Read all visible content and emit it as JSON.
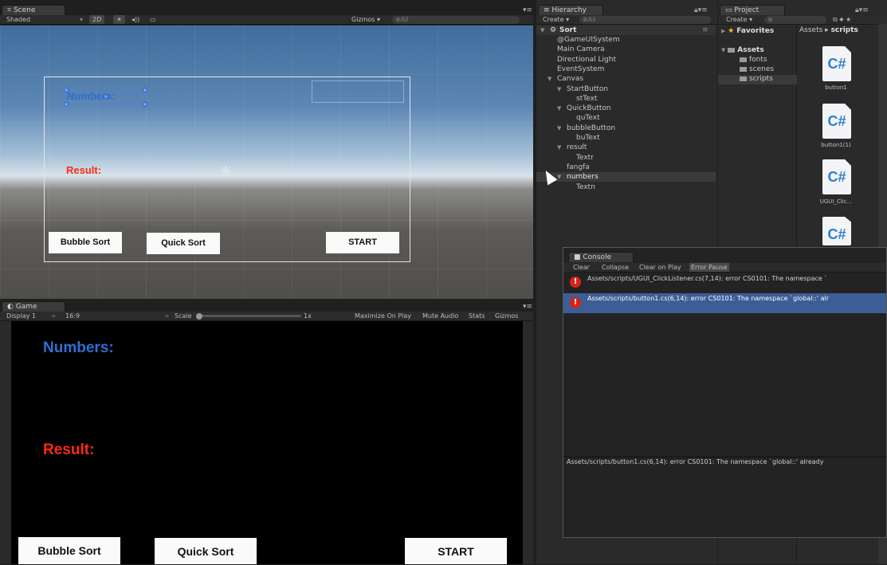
{
  "scene": {
    "tab": "Scene",
    "toolbar": {
      "shading": "Shaded",
      "mode2d": "2D",
      "light": "☀",
      "audio": "◂))",
      "fx": "▭",
      "gizmos": "Gizmos ▾",
      "search": "⊕All"
    },
    "canvas_labels": {
      "numbers": "Numbers:",
      "result": "Result:"
    },
    "buttons": {
      "bubble": "Bubble Sort",
      "quick": "Quick Sort",
      "start": "START"
    }
  },
  "game": {
    "tab": "Game",
    "toolbar": {
      "display": "Display 1",
      "aspect": "16:9",
      "scale_label": "Scale",
      "scale_value": "1x",
      "maximize": "Maximize On Play",
      "mute": "Mute Audio",
      "stats": "Stats",
      "gizmos": "Gizmos"
    },
    "labels": {
      "numbers": "Numbers:",
      "result": "Result:"
    },
    "buttons": {
      "bubble": "Bubble Sort",
      "quick": "Quick Sort",
      "start": "START"
    }
  },
  "hierarchy": {
    "tab": "Hierarchy",
    "create": "Create ▾",
    "search": "⊕All",
    "scene_name": "Sort",
    "items": [
      {
        "label": "@GameUISystem",
        "indent": 0,
        "arrow": false
      },
      {
        "label": "Main Camera",
        "indent": 0,
        "arrow": false
      },
      {
        "label": "Directional Light",
        "indent": 0,
        "arrow": false
      },
      {
        "label": "EventSystem",
        "indent": 0,
        "arrow": false
      },
      {
        "label": "Canvas",
        "indent": 0,
        "arrow": true
      },
      {
        "label": "StartButton",
        "indent": 1,
        "arrow": true
      },
      {
        "label": "stText",
        "indent": 2,
        "arrow": false
      },
      {
        "label": "QuickButton",
        "indent": 1,
        "arrow": true
      },
      {
        "label": "quText",
        "indent": 2,
        "arrow": false
      },
      {
        "label": "bubbleButton",
        "indent": 1,
        "arrow": true
      },
      {
        "label": "buText",
        "indent": 2,
        "arrow": false
      },
      {
        "label": "result",
        "indent": 1,
        "arrow": true
      },
      {
        "label": "Textr",
        "indent": 2,
        "arrow": false
      },
      {
        "label": "fangfa",
        "indent": 1,
        "arrow": false
      },
      {
        "label": "numbers",
        "indent": 1,
        "arrow": true,
        "selected": true
      },
      {
        "label": "Textn",
        "indent": 2,
        "arrow": false
      }
    ]
  },
  "project": {
    "tab": "Project",
    "create": "Create ▾",
    "favorites": "Favorites",
    "assets": "Assets",
    "folders": [
      "fonts",
      "scenes",
      "scripts"
    ],
    "breadcrumb": {
      "root": "Assets",
      "sep": "▸",
      "current": "scripts"
    },
    "files": [
      "button1",
      "button1(1)",
      "UGUI_Clic..."
    ],
    "cs_glyph": "C#"
  },
  "console": {
    "tab": "Console",
    "buttons": [
      "Clear",
      "Collapse",
      "Clear on Play",
      "Error Pause"
    ],
    "errors": [
      "Assets/scripts/UGUI_ClickListener.cs(7,14): error CS0101: The namespace `",
      "Assets/scripts/button1.cs(6,14): error CS0101: The namespace `global::' alr"
    ],
    "detail": "Assets/scripts/button1.cs(6,14): error CS0101: The namespace `global::' already"
  },
  "colors": {
    "numbers_blue": "#2f6fd0",
    "result_red": "#ff2a14",
    "selection": "#3c5e96",
    "error_red": "#d4231a"
  }
}
